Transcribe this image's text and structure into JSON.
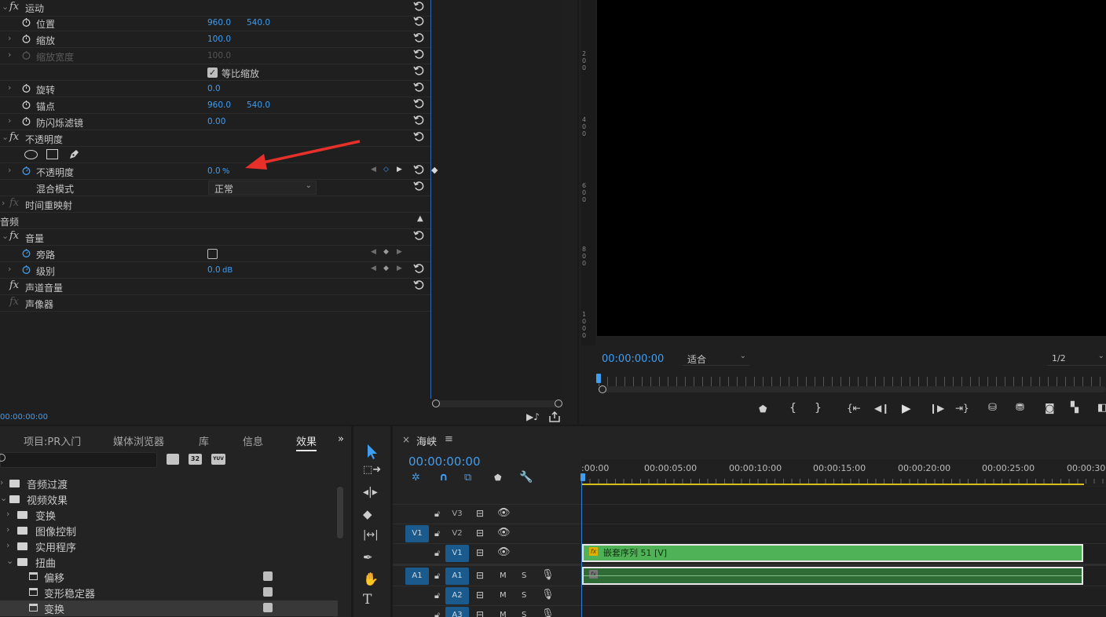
{
  "effects": {
    "motion": {
      "label": "运动"
    },
    "position": {
      "label": "位置",
      "x": "960.0",
      "y": "540.0"
    },
    "scale": {
      "label": "缩放",
      "value": "100.0"
    },
    "scale_width": {
      "label": "缩放宽度",
      "value": "100.0"
    },
    "uniform_scale": {
      "label": "等比缩放",
      "checked": true
    },
    "rotation": {
      "label": "旋转",
      "value": "0.0"
    },
    "anchor": {
      "label": "锚点",
      "x": "960.0",
      "y": "540.0"
    },
    "anti_flicker": {
      "label": "防闪烁滤镜",
      "value": "0.00"
    },
    "opacity_group": {
      "label": "不透明度"
    },
    "opacity": {
      "label": "不透明度",
      "value": "0.0",
      "unit": "%"
    },
    "blend_mode": {
      "label": "混合模式",
      "value": "正常"
    },
    "time_remap": {
      "label": "时间重映射"
    },
    "audio_header": "音频",
    "volume": {
      "label": "音量"
    },
    "bypass": {
      "label": "旁路"
    },
    "level": {
      "label": "级别",
      "value": "0.0",
      "unit": "dB"
    },
    "channel_volume": {
      "label": "声道音量"
    },
    "panner": {
      "label": "声像器"
    },
    "timecode": "00:00:00:00",
    "fx_icon": "fx"
  },
  "monitor": {
    "timecode": "00:00:00:00",
    "fit": "适合",
    "resolution": "1/2",
    "ruler_marks": [
      "2\n0\n0",
      "4\n0\n0",
      "6\n0\n0",
      "8\n0\n0",
      "1\n0\n0\n0"
    ]
  },
  "project_panel": {
    "tabs": [
      "项目:PR入门",
      "媒体浏览器",
      "库",
      "信息",
      "效果"
    ],
    "active_tab": "效果",
    "overflow": "»",
    "tree": [
      {
        "label": "音频过渡",
        "level": 0,
        "type": "folder",
        "open": false
      },
      {
        "label": "视频效果",
        "level": 0,
        "type": "folder",
        "open": true
      },
      {
        "label": "变换",
        "level": 1,
        "type": "folder",
        "open": false
      },
      {
        "label": "图像控制",
        "level": 1,
        "type": "folder",
        "open": false
      },
      {
        "label": "实用程序",
        "level": 1,
        "type": "folder",
        "open": false
      },
      {
        "label": "扭曲",
        "level": 1,
        "type": "folder",
        "open": true
      },
      {
        "label": "偏移",
        "level": 2,
        "type": "effect"
      },
      {
        "label": "变形稳定器",
        "level": 2,
        "type": "effect"
      },
      {
        "label": "变换",
        "level": 2,
        "type": "effect",
        "selected": true
      }
    ],
    "badges": [
      "32",
      "YUV"
    ]
  },
  "timeline": {
    "close": "×",
    "title": "海峡",
    "menu": "≡",
    "timecode": "00:00:00:00",
    "ruler": [
      ":00:00",
      "00:00:05:00",
      "00:00:10:00",
      "00:00:15:00",
      "00:00:20:00",
      "00:00:25:00",
      "00:00:30:00"
    ],
    "video_tracks": [
      {
        "src": "",
        "name": "V3"
      },
      {
        "src": "V1",
        "name": "V2"
      },
      {
        "src": "",
        "name": "V1"
      }
    ],
    "audio_tracks": [
      {
        "src": "A1",
        "name": "A1"
      },
      {
        "src": "",
        "name": "A2"
      },
      {
        "src": "",
        "name": "A3"
      }
    ],
    "mute": "M",
    "solo": "S",
    "clip_label": "嵌套序列 51 [V]",
    "clip_fx": "fx"
  },
  "colors": {
    "accent": "#3f9df2",
    "clip_green": "#4fb257",
    "playhead": "#2d7fd6",
    "annotation": "#e8302a"
  }
}
